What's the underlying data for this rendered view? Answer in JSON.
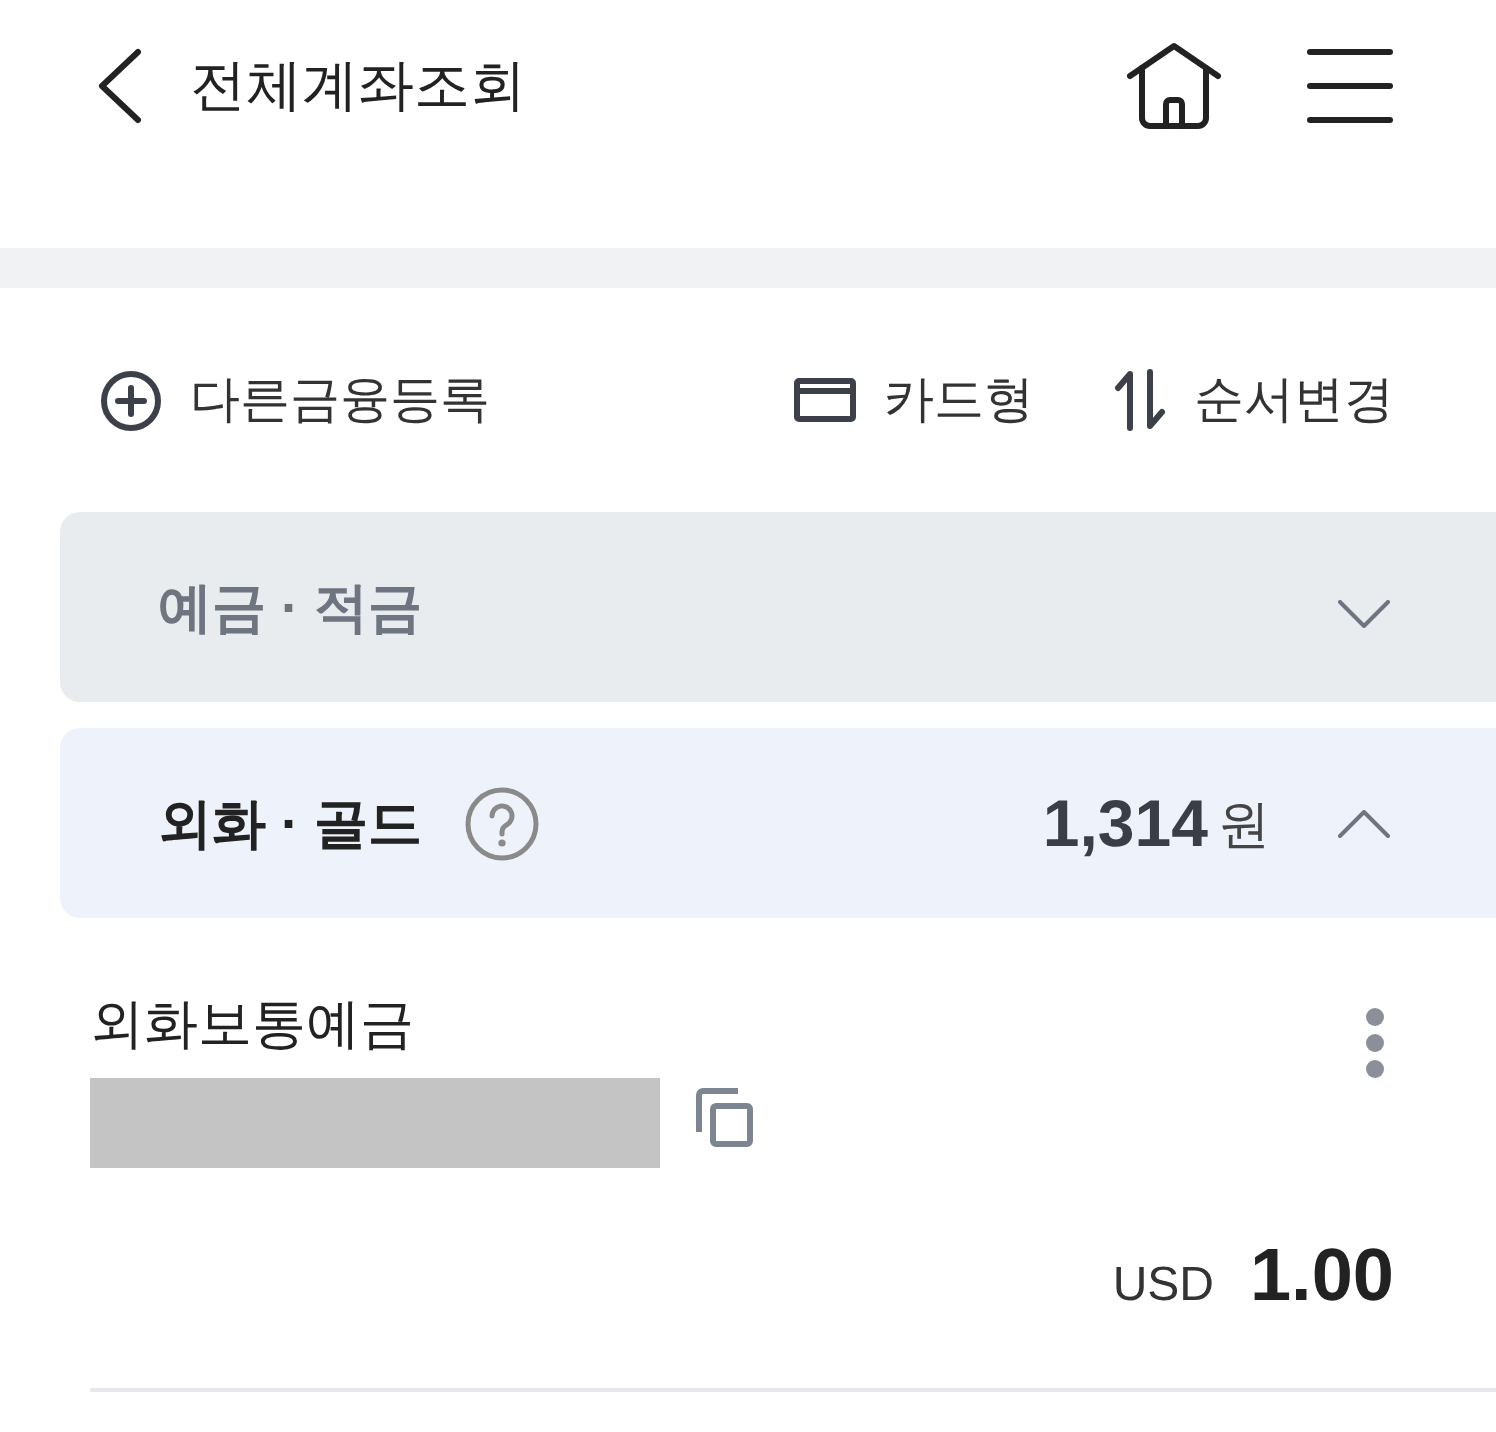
{
  "header": {
    "title": "전체계좌조회"
  },
  "toolbar": {
    "add_button": "다른금융등록",
    "view_button": "카드형",
    "sort_button": "순서변경"
  },
  "groups": [
    {
      "title": "예금 · 적금",
      "help_icon": false,
      "expanded": false
    },
    {
      "title": "외화 · 골드",
      "help_icon": true,
      "expanded": true,
      "total": {
        "amount": "1,314",
        "unit": "원"
      },
      "accounts": [
        {
          "name": "외화보통예금",
          "currency": "USD",
          "balance": "1.00"
        }
      ]
    }
  ]
}
